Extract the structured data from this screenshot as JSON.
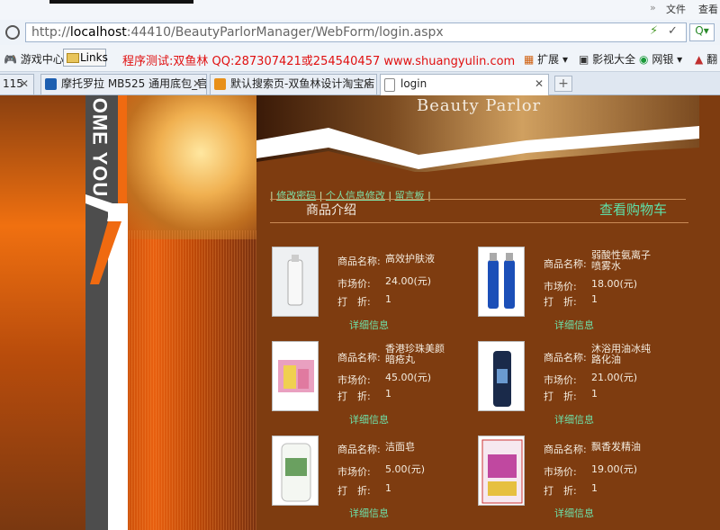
{
  "browser": {
    "menu": {
      "file": "文件",
      "view": "查看",
      "more": "»"
    },
    "address": {
      "host": "localhost",
      "prefix": "http://",
      "rest": ":44410/BeautyParlorManager/WebForm/login.aspx"
    },
    "bookmarks": {
      "games": "游戏中心",
      "links": "Links",
      "ad_text": "程序测试:双鱼林 QQ:287307421或254540457 www.shuangyulin.com",
      "ext": "扩展",
      "video": "影视大全",
      "bank": "网银",
      "translate": "翻"
    },
    "tabs": [
      {
        "label": "115"
      },
      {
        "label": "摩托罗拉 MB525 通用底包_官"
      },
      {
        "label": "默认搜索页-双鱼林设计淘宝店"
      },
      {
        "label": "login"
      }
    ],
    "new_tab": "+"
  },
  "site": {
    "logo_text": "OME YOU",
    "header_title": "Beauty Parlor",
    "nav": [
      "修改密码",
      "个人信息修改",
      "留言板"
    ],
    "section_title": "商品介绍",
    "cart_link": "查看购物车"
  },
  "labels": {
    "name": "商品名称:",
    "price": "市场价:",
    "discount": "打　折:",
    "detail": "详细信息"
  },
  "products": [
    {
      "name": "高效护肤液",
      "price": "24.00(元)",
      "discount": "1"
    },
    {
      "name": "弱酸性氨离子喷雾水",
      "price": "18.00(元)",
      "discount": "1"
    },
    {
      "name": "香港珍珠美颜暗疮丸",
      "price": "45.00(元)",
      "discount": "1"
    },
    {
      "name": "沐浴用油冰纯路化油",
      "price": "21.00(元)",
      "discount": "1"
    },
    {
      "name": "洁面皂",
      "price": "5.00(元)",
      "discount": "1"
    },
    {
      "name": "飘香发精油",
      "price": "19.00(元)",
      "discount": "1"
    }
  ]
}
